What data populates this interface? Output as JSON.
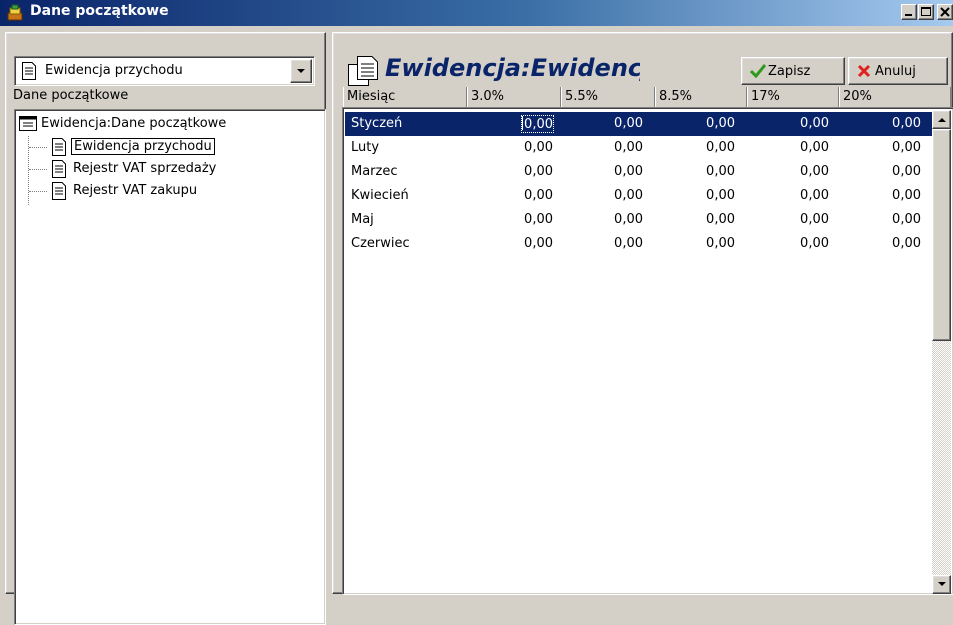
{
  "window": {
    "title": "Dane początkowe",
    "controls": [
      "minimize-icon",
      "maximize-icon",
      "close-icon"
    ]
  },
  "left_panel": {
    "combo_value": "Ewidencja przychodu",
    "section_label": "Dane początkowe",
    "tree": {
      "root": "Ewidencja:Dane początkowe",
      "items": [
        {
          "label": "Ewidencja przychodu",
          "focused": true
        },
        {
          "label": "Rejestr VAT sprzedaży",
          "focused": false
        },
        {
          "label": "Rejestr VAT zakupu",
          "focused": false
        }
      ]
    }
  },
  "right_panel": {
    "header_title": "Ewidencja:Ewidencja przychodu",
    "save_label": "Zapisz",
    "cancel_label": "Anuluj",
    "columns": [
      "Miesiąc",
      "3.0%",
      "5.5%",
      "8.5%",
      "17%",
      "20%"
    ],
    "rows": [
      {
        "month": "Styczeń",
        "values": [
          "0,00",
          "0,00",
          "0,00",
          "0,00",
          "0,00"
        ],
        "selected": true
      },
      {
        "month": "Luty",
        "values": [
          "0,00",
          "0,00",
          "0,00",
          "0,00",
          "0,00"
        ],
        "selected": false
      },
      {
        "month": "Marzec",
        "values": [
          "0,00",
          "0,00",
          "0,00",
          "0,00",
          "0,00"
        ],
        "selected": false
      },
      {
        "month": "Kwiecień",
        "values": [
          "0,00",
          "0,00",
          "0,00",
          "0,00",
          "0,00"
        ],
        "selected": false
      },
      {
        "month": "Maj",
        "values": [
          "0,00",
          "0,00",
          "0,00",
          "0,00",
          "0,00"
        ],
        "selected": false
      },
      {
        "month": "Czerwiec",
        "values": [
          "0,00",
          "0,00",
          "0,00",
          "0,00",
          "0,00"
        ],
        "selected": false
      }
    ]
  },
  "colors": {
    "title_gradient_start": "#0a246a",
    "title_gradient_end": "#a6caf0",
    "selection": "#0a246a",
    "save_icon": "#2e9a1c",
    "cancel_icon": "#e0201c"
  }
}
